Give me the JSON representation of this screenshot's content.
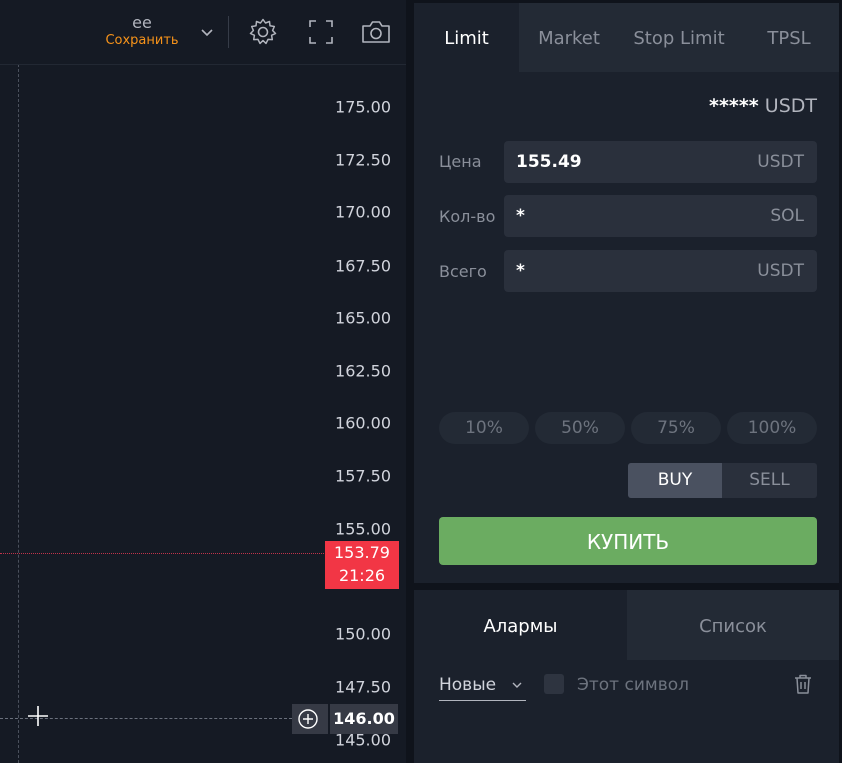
{
  "toolbar": {
    "layout_name": "ee",
    "save_label": "Сохранить",
    "icons": [
      "chevron-down-icon",
      "gear-icon",
      "fullscreen-icon",
      "camera-icon"
    ]
  },
  "price_axis": {
    "ticks": [
      "175.00",
      "172.50",
      "170.00",
      "167.50",
      "165.00",
      "162.50",
      "160.00",
      "157.50",
      "155.00",
      "150.00",
      "147.50",
      "145.00"
    ],
    "last_price": "153.79",
    "countdown": "21:26",
    "crosshair_price": "146.00"
  },
  "order_tabs": [
    "Limit",
    "Market",
    "Stop Limit",
    "TPSL"
  ],
  "order": {
    "balance_mask": "*****",
    "balance_unit": "USDT",
    "price_label": "Цена",
    "price_value": "155.49",
    "price_unit": "USDT",
    "qty_label": "Кол-во",
    "qty_value": "*",
    "qty_unit": "SOL",
    "total_label": "Всего",
    "total_value": "*",
    "total_unit": "USDT",
    "percents": [
      "10%",
      "50%",
      "75%",
      "100%"
    ],
    "buy_label": "BUY",
    "sell_label": "SELL",
    "submit_label": "КУПИТЬ"
  },
  "alarms": {
    "tab_alarms": "Алармы",
    "tab_list": "Список",
    "filter_value": "Новые",
    "checkbox_label": "Этот символ"
  },
  "colors": {
    "accent_orange": "#f7931a",
    "buy_green": "#6bac61",
    "price_red": "#f23645"
  }
}
